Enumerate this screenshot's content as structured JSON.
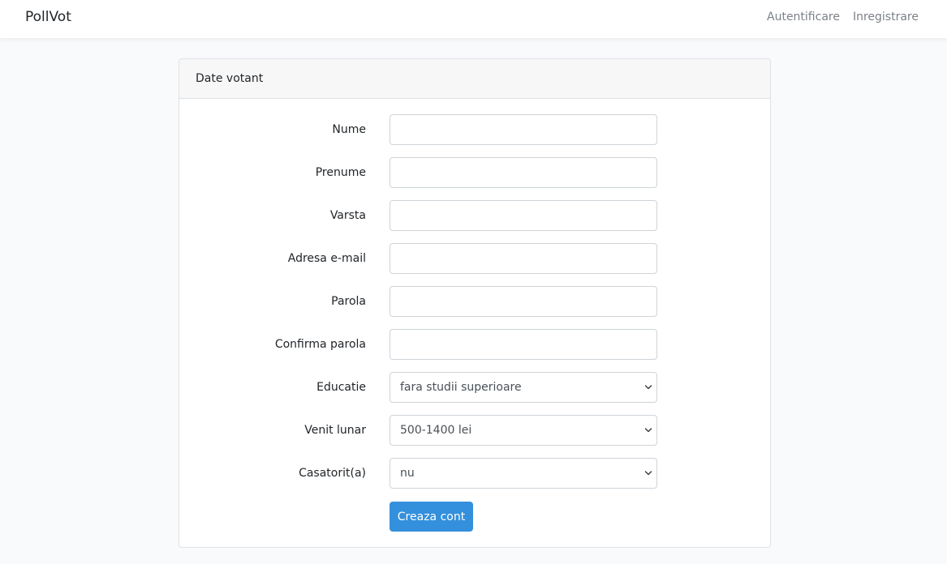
{
  "navbar": {
    "brand": "PollVot",
    "links": [
      "Autentificare",
      "Inregistrare"
    ]
  },
  "card": {
    "header": "Date votant",
    "fields": [
      {
        "label": "Nume",
        "value": ""
      },
      {
        "label": "Prenume",
        "value": ""
      },
      {
        "label": "Varsta",
        "value": ""
      },
      {
        "label": "Adresa e-mail",
        "value": ""
      },
      {
        "label": "Parola",
        "value": ""
      },
      {
        "label": "Confirma parola",
        "value": ""
      }
    ],
    "selects": [
      {
        "label": "Educatie",
        "selected": "fara studii superioare"
      },
      {
        "label": "Venit lunar",
        "selected": "500-1400 lei"
      },
      {
        "label": "Casatorit(a)",
        "selected": "nu"
      }
    ],
    "submit_label": "Creaza cont"
  },
  "colors": {
    "primary": "#3490dc",
    "background": "#f8fafc"
  }
}
